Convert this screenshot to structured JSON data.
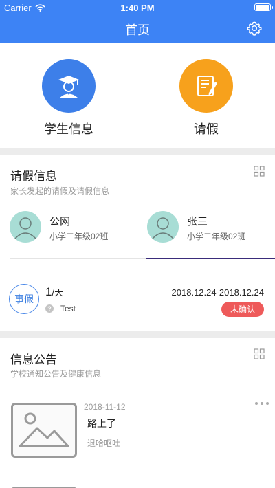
{
  "status_bar": {
    "carrier": "Carrier",
    "time": "1:40 PM"
  },
  "nav": {
    "title": "首页"
  },
  "quick_actions": [
    {
      "label": "学生信息",
      "color": "#3d7fe9"
    },
    {
      "label": "请假",
      "color": "#f7a11c"
    }
  ],
  "leave_section": {
    "title": "请假信息",
    "subtitle": "家长发起的请假及请假信息",
    "students": [
      {
        "name": "公网",
        "class": "小学二年级02班"
      },
      {
        "name": "张三",
        "class": "小学二年级02班"
      }
    ],
    "record": {
      "badge": "事假",
      "duration": "1",
      "unit": "/天",
      "reason": "Test",
      "date_range": "2018.12.24-2018.12.24",
      "status": "未确认"
    }
  },
  "notice_section": {
    "title": "信息公告",
    "subtitle": "学校通知公告及健康信息",
    "items": [
      {
        "date": "2018-11-12",
        "title": "路上了",
        "desc": "退哈呕吐"
      }
    ]
  },
  "colors": {
    "primary": "#3d83f5",
    "accent_red": "#ee5a5a",
    "avatar_bg": "#a8ddd5"
  }
}
